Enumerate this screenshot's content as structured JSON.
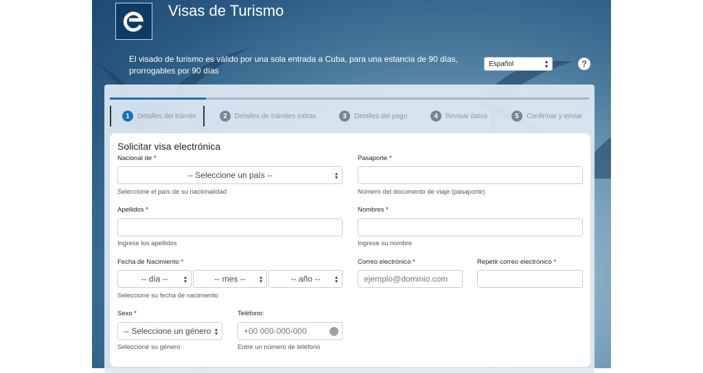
{
  "header": {
    "title": "Visas de Turismo",
    "subtitle": "El visado de turismo es válido por una sola entrada a Cuba, para una estancia de 90 días, prorrogables por 90 días",
    "language": "Español",
    "help": "?"
  },
  "steps": [
    {
      "num": "1",
      "label": "Detalles del trámite"
    },
    {
      "num": "2",
      "label": "Detalles de trámites extras"
    },
    {
      "num": "3",
      "label": "Detalles del pago"
    },
    {
      "num": "4",
      "label": "Revisar datos"
    },
    {
      "num": "5",
      "label": "Confirmar y enviar"
    }
  ],
  "progress": 0.2,
  "form": {
    "title": "Solicitar visa electrónica",
    "nacional": {
      "label": "Nacional de *",
      "value": "-- Seleccione un país --",
      "hint": "Seleccione el país de su nacionalidad"
    },
    "pasaporte": {
      "label": "Pasaporte *",
      "value": "",
      "hint": "Número del documento de viaje (pasaporte)"
    },
    "apellidos": {
      "label": "Apellidos *",
      "value": "",
      "hint": "Ingrese los apellidos"
    },
    "nombres": {
      "label": "Nombres *",
      "value": "",
      "hint": "Ingrese su nombre"
    },
    "fecha": {
      "label": "Fecha de Nacimiento *",
      "dia": "-- día --",
      "mes": "-- mes --",
      "anio": "-- año --",
      "hint": "Seleccione su fecha de nacimiento"
    },
    "correo": {
      "label": "Correo electrónico *",
      "placeholder": "ejemplo@dominio.com"
    },
    "repetir_correo": {
      "label": "Repetir correo electrónico *",
      "value": ""
    },
    "sexo": {
      "label": "Sexo *",
      "value": "-- Seleccione un género",
      "hint": "Seleccione su género"
    },
    "telefono": {
      "label": "Teléfono:",
      "placeholder": "+00 000-000-000",
      "hint": "Entre un número de teléfono"
    }
  }
}
